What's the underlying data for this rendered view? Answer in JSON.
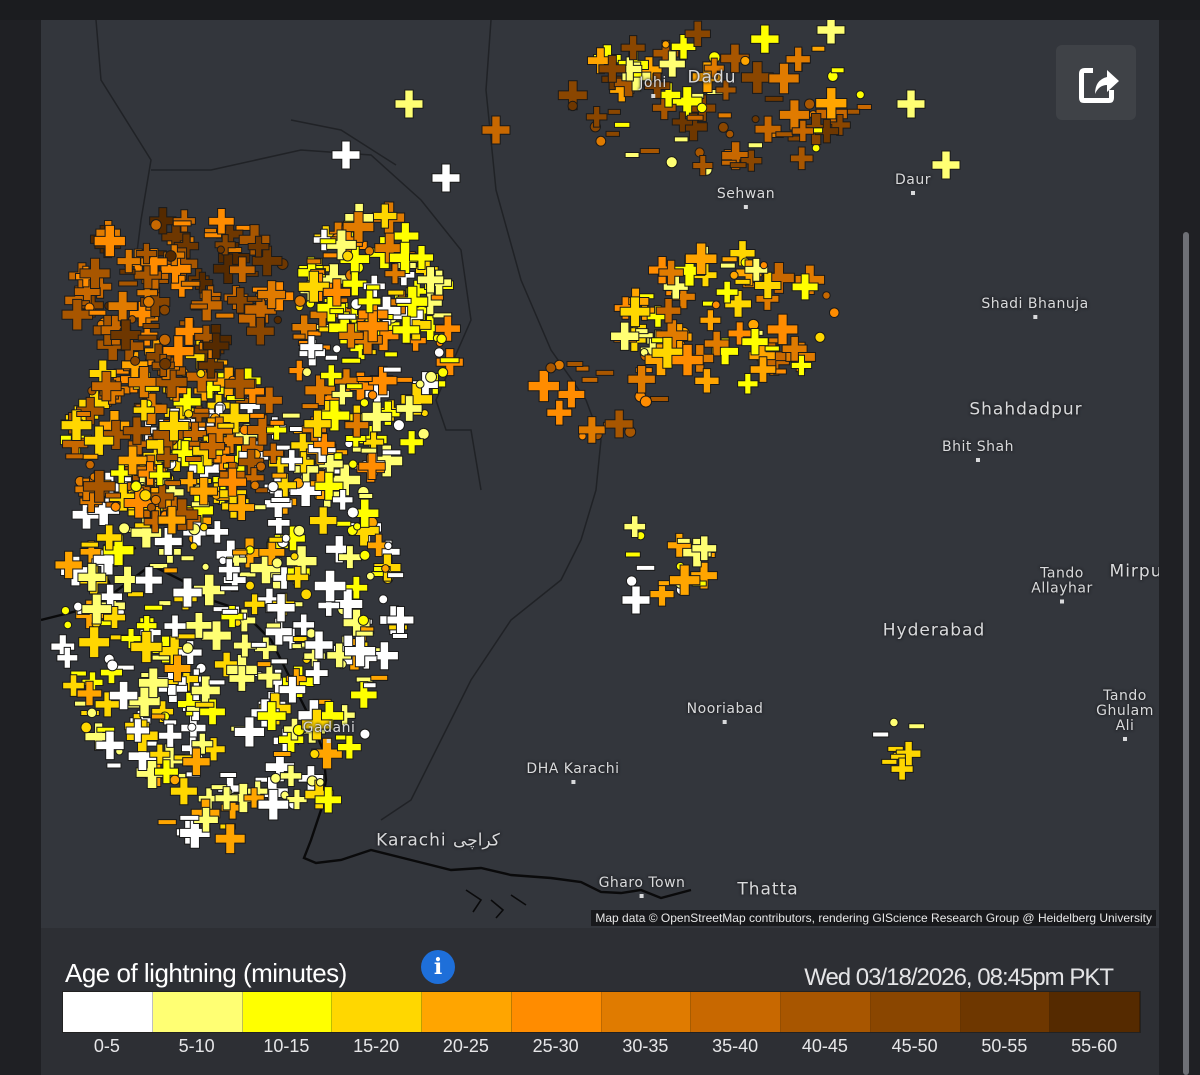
{
  "map": {
    "places": [
      {
        "name": "Johi",
        "small": true
      },
      {
        "name": "Dadu"
      },
      {
        "name": "Sehwan",
        "small": true
      },
      {
        "name": "Daur",
        "small": true
      },
      {
        "name": "Shadi Bhanuja",
        "small": true
      },
      {
        "name": "Shahdadpur"
      },
      {
        "name": "Bhit Shah",
        "small": true
      },
      {
        "name": "Tando Allayhar",
        "small": true
      },
      {
        "name": "Mirpu"
      },
      {
        "name": "Hyderabad"
      },
      {
        "name": "Nooriabad",
        "small": true
      },
      {
        "name": "Tando Ghulam Ali",
        "small": true
      },
      {
        "name": "Gadani",
        "small": true
      },
      {
        "name": "DHA Karachi",
        "small": true
      },
      {
        "name": "Karachi كراچی"
      },
      {
        "name": "Gharo Town",
        "small": true
      },
      {
        "name": "Thatta"
      }
    ],
    "attribution": "Map data © OpenStreetMap contributors, rendering GIScience Research Group @ Heidelberg University",
    "share_icon": "share-icon"
  },
  "legend": {
    "title": "Age of lightning (minutes)",
    "info_icon": "info-icon",
    "timestamp": "Wed 03/18/2026, 08:45pm PKT",
    "bins": [
      {
        "label": "0-5",
        "color": "#ffffff"
      },
      {
        "label": "5-10",
        "color": "#ffff73"
      },
      {
        "label": "10-15",
        "color": "#ffff00"
      },
      {
        "label": "15-20",
        "color": "#ffd700"
      },
      {
        "label": "20-25",
        "color": "#ffa500"
      },
      {
        "label": "25-30",
        "color": "#ff8c00"
      },
      {
        "label": "30-35",
        "color": "#e07b00"
      },
      {
        "label": "35-40",
        "color": "#c86800"
      },
      {
        "label": "40-45",
        "color": "#a85600"
      },
      {
        "label": "45-50",
        "color": "#8a4600"
      },
      {
        "label": "50-55",
        "color": "#6e3700"
      },
      {
        "label": "55-60",
        "color": "#552a00"
      }
    ]
  }
}
